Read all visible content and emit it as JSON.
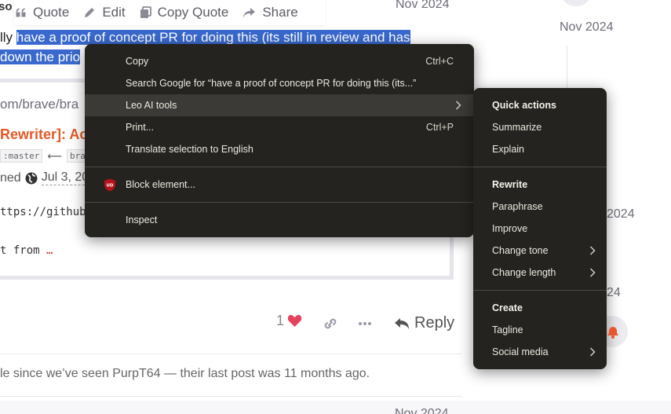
{
  "post": {
    "username_fragment": "so",
    "toolbar": {
      "quote_label": "Quote",
      "edit_label": "Edit",
      "copy_quote_label": "Copy Quote",
      "share_label": "Share"
    },
    "date": "Nov 2024",
    "line1_prefix": "lly ",
    "line1_selected": "have a proof of concept PR for doing this (its still in review and has",
    "line2_selected": "down the prio",
    "onebox": {
      "url_fragment": "om/brave/bra",
      "pr_title_fragment": "Rewriter]: Ac",
      "branch_left": ":master",
      "arrow": "⟵",
      "branch_right": "brave",
      "opened_label": "ned",
      "opened_date": "Jul 3, 20",
      "code_line1": "ttps://github",
      "code_line2_prefix": "t from ",
      "code_line2_ellipsis": "…"
    },
    "actions": {
      "like_count": "1",
      "reply_label": "Reply"
    },
    "notice": "le since we’ve seen PurpT64 — their last post was 11 months ago.",
    "bottom_date": "Nov 2024"
  },
  "timeline": {
    "top_date": "Nov 2024",
    "frag1": "2024",
    "frag2": "24"
  },
  "context_menu": {
    "items": [
      {
        "label": "Copy",
        "shortcut": "Ctrl+C"
      },
      {
        "label": "Search Google for “have a proof of concept PR for doing this (its...”",
        "shortcut": ""
      },
      {
        "label": "Leo AI tools",
        "shortcut": ""
      },
      {
        "label": "Print...",
        "shortcut": "Ctrl+P"
      },
      {
        "label": "Translate selection to English",
        "shortcut": ""
      },
      {
        "label": "Block element...",
        "shortcut": ""
      },
      {
        "label": "Inspect",
        "shortcut": ""
      }
    ],
    "ublock_icon_text": "UD"
  },
  "leo_submenu": {
    "quick_actions_header": "Quick actions",
    "summarize": "Summarize",
    "explain": "Explain",
    "rewrite_header": "Rewrite",
    "paraphrase": "Paraphrase",
    "improve": "Improve",
    "change_tone": "Change tone",
    "change_length": "Change length",
    "create_header": "Create",
    "tagline": "Tagline",
    "social_media": "Social media"
  },
  "colors": {
    "menu_bg": "#24231f",
    "menu_hover": "#3b3a36",
    "selection": "#3969ce",
    "heart": "#e4435e",
    "pr_title": "#e45a26",
    "bell": "#e8542c"
  }
}
